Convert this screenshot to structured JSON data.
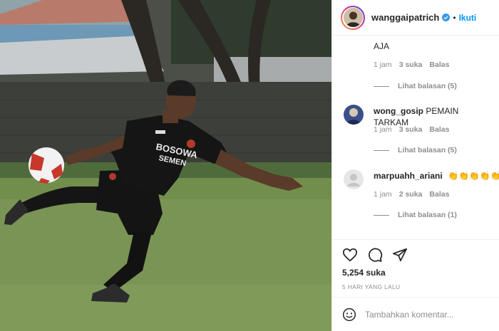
{
  "header": {
    "username": "wanggaipatrich",
    "separator": "•",
    "follow_label": "Ikuti"
  },
  "comments": [
    {
      "text": "AJA",
      "time": "1 jam",
      "likes": "3 suka",
      "reply_label": "Balas",
      "view_replies": "Lihat balasan (5)"
    },
    {
      "user": "wong_gosip",
      "text": "PEMAIN TARKAM",
      "time": "1 jam",
      "likes": "3 suka",
      "reply_label": "Balas",
      "view_replies": "Lihat balasan (5)"
    },
    {
      "user": "marpuahh_ariani",
      "emojis": [
        "clapping-hands",
        "clapping-hands",
        "clapping-hands",
        "clapping-hands",
        "clapping-hands"
      ],
      "time": "1 jam",
      "likes": "2 suka",
      "reply_label": "Balas",
      "view_replies": "Lihat balasan (1)"
    }
  ],
  "actions": {
    "like_icon": "heart-icon",
    "comment_icon": "speech-bubble-icon",
    "share_icon": "paper-plane-icon",
    "likes_count": "5,254 suka",
    "posted_time": "5 HARI YANG LALU"
  },
  "add_comment": {
    "placeholder": "Tambahkan komentar..."
  },
  "photo": {
    "jersey_text_line1": "BOSOWA",
    "jersey_text_line2": "SEMEN",
    "colors": {
      "grass": "#7a9455",
      "jersey": "#151515",
      "skin": "#5a3a28",
      "accent": "#0095f6"
    }
  }
}
